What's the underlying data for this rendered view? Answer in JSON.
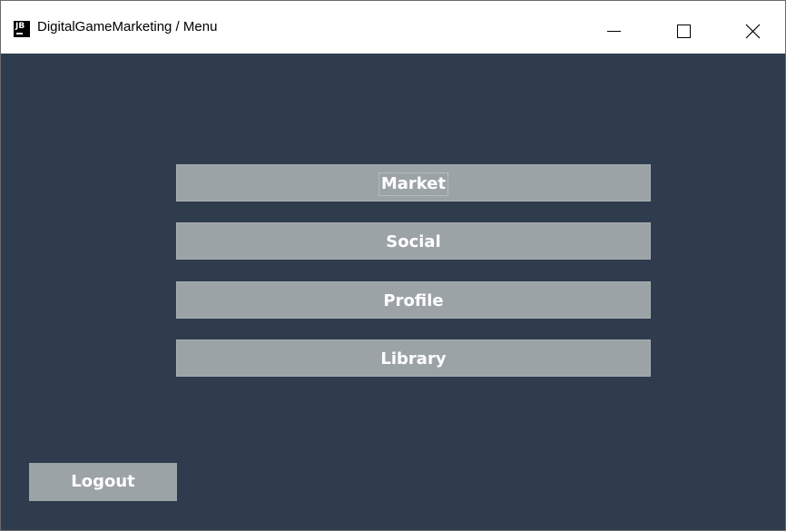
{
  "window": {
    "app_icon_text": "JB",
    "title": "DigitalGameMarketing / Menu",
    "controls": {
      "minimize": "minimize-icon",
      "maximize": "maximize-icon",
      "close": "close-icon"
    }
  },
  "menu": {
    "items": [
      {
        "label": "Market"
      },
      {
        "label": "Social"
      },
      {
        "label": "Profile"
      },
      {
        "label": "Library"
      }
    ]
  },
  "footer": {
    "logout_label": "Logout"
  },
  "colors": {
    "background": "#2e3c4e",
    "button": "#9ca3a7",
    "button_text": "#ffffff"
  }
}
